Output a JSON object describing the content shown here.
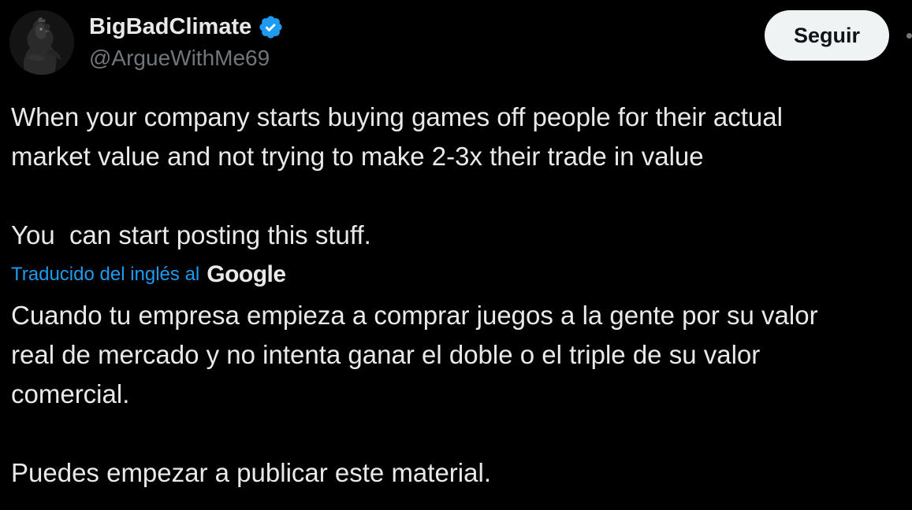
{
  "author": {
    "display_name": "BigBadClimate",
    "handle": "@ArgueWithMe69",
    "verified": true,
    "avatar_icon": "rooster-avatar"
  },
  "follow_button": {
    "label": "Seguir"
  },
  "tweet": {
    "original_text": "When your company starts buying games off people for their actual\nmarket value and not trying to make 2-3x their trade in value\n\nYou  can start posting this stuff.",
    "translation_label": "Traducido del inglés al",
    "translation_provider": "Google",
    "translated_text": "Cuando tu empresa empieza a comprar juegos a la gente por su valor\nreal de mercado y no intenta ganar el doble o el triple de su valor\ncomercial.\n\nPuedes empezar a publicar este material."
  },
  "colors": {
    "background": "#000000",
    "primary_text": "#e7e9ea",
    "secondary_text": "#71767b",
    "accent": "#1d9bf0",
    "follow_button_bg": "#eff3f4"
  }
}
